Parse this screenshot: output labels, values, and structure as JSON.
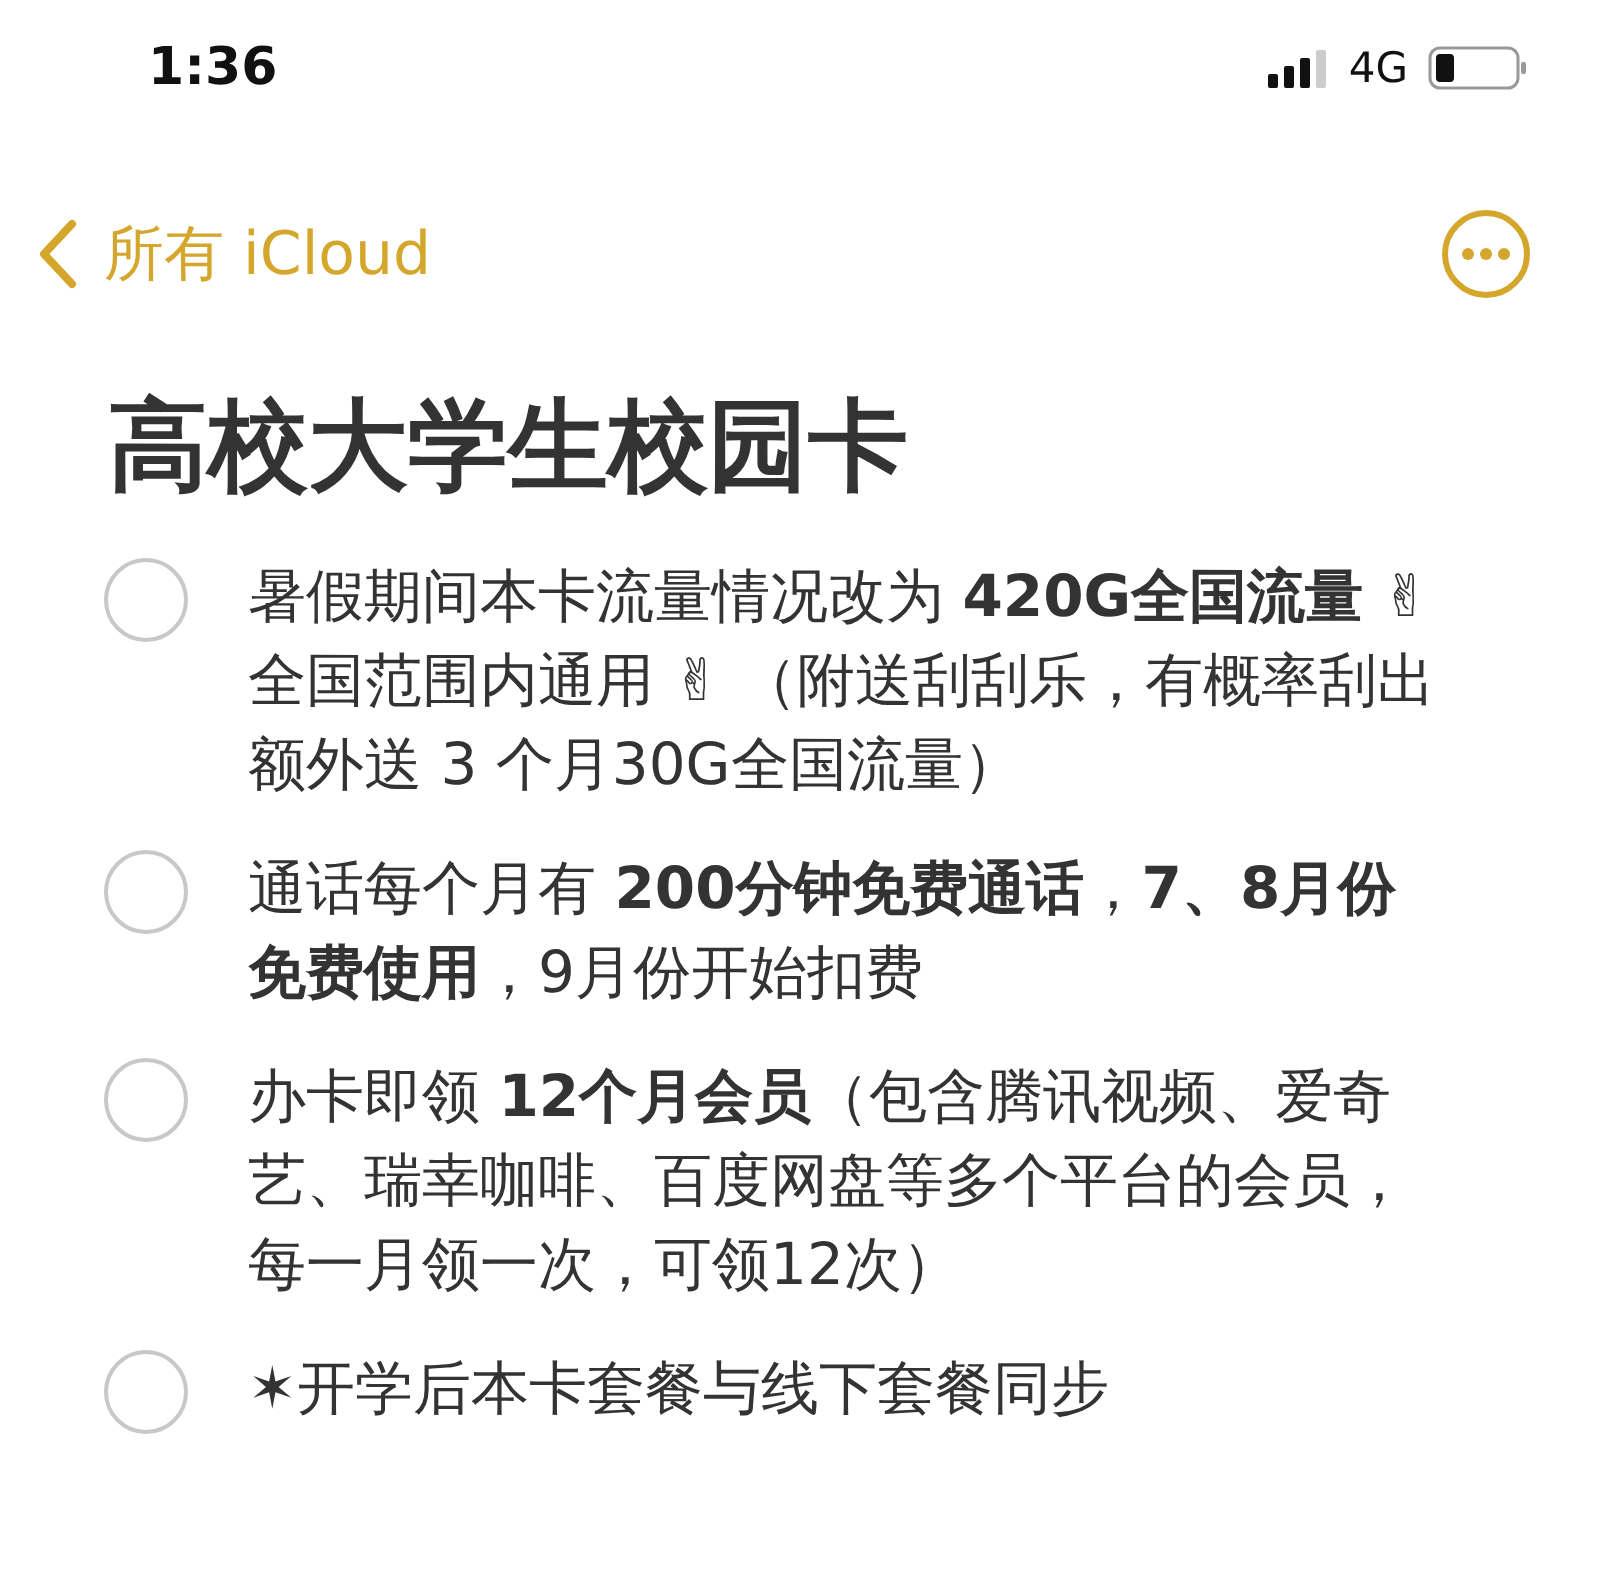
{
  "status_bar": {
    "time": "1:36",
    "network": "4G"
  },
  "nav": {
    "back_label": "所有 iCloud"
  },
  "note": {
    "title": "高校大学生校园卡",
    "checklist": [
      {
        "text": "暑假期间本卡流量情况改为 **420G全国流量** ✌ 全国范围内通用 ✌ （附送刮刮乐，有概率刮出额外送 3 个月30G全国流量）",
        "checked": false
      },
      {
        "text": "通话每个月有 **200分钟免费通话**，**7、8月份免费使用**，9月份开始扣费",
        "checked": false
      },
      {
        "text": "办卡即领 **12个月会员**（包含腾讯视频、爱奇艺、瑞幸咖啡、百度网盘等多个平台的会员，每一月领一次，可领12次）",
        "checked": false
      },
      {
        "text": "✶开学后本卡套餐与线下套餐同步",
        "checked": false
      }
    ]
  }
}
